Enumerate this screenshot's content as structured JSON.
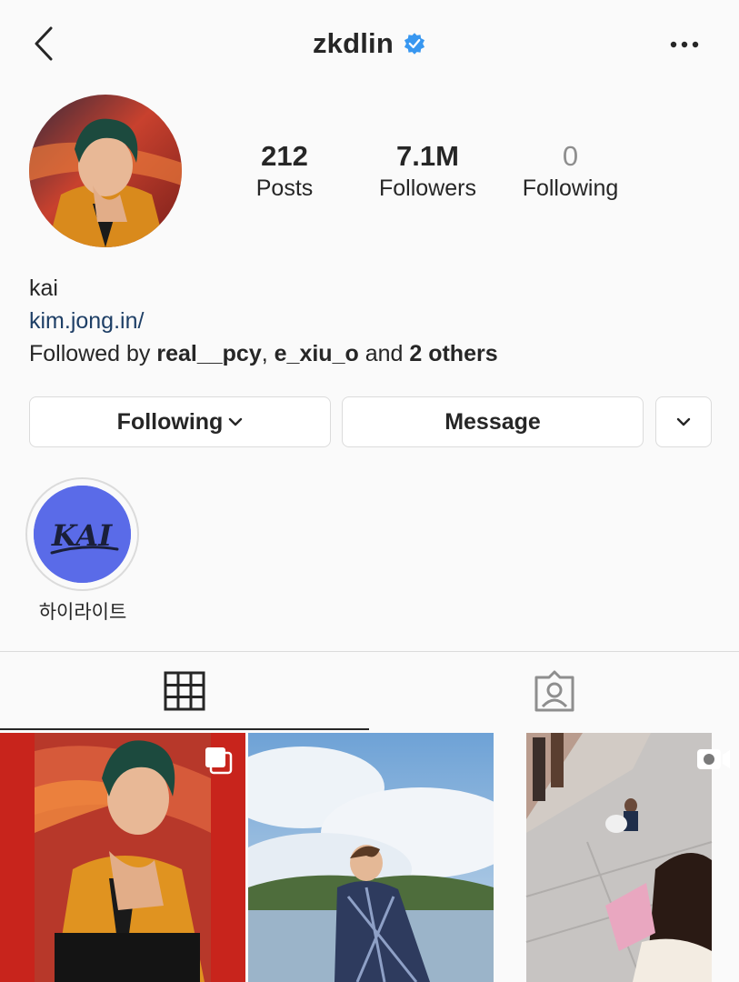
{
  "header": {
    "username": "zkdlin",
    "verified": true,
    "icons": [
      "chevron-left-icon",
      "verified-badge-icon",
      "more-horizontal-icon"
    ]
  },
  "profile": {
    "stats": [
      {
        "value": "212",
        "label": "Posts"
      },
      {
        "value": "7.1M",
        "label": "Followers"
      },
      {
        "value": "0",
        "label": "Following"
      }
    ],
    "name": "kai",
    "link": "kim.jong.in/",
    "followed_by": {
      "prefix": "Followed by ",
      "user1": "real__pcy",
      "sep": ", ",
      "user2": "e_xiu_o",
      "mid": " and ",
      "others": "2 others"
    }
  },
  "actions": {
    "following_label": "Following",
    "message_label": "Message"
  },
  "highlights": [
    {
      "label": "하이라이트",
      "cover_text": "KAI"
    }
  ],
  "tabs": {
    "active": "grid",
    "items": [
      "grid-icon",
      "tagged-icon"
    ]
  },
  "posts": [
    {
      "type": "carousel"
    },
    {
      "type": "photo"
    },
    {
      "type": "video"
    }
  ],
  "colors": {
    "background": "#fafafa",
    "text": "#262626",
    "muted": "#8e8e8e",
    "link": "#1e3f66",
    "border": "#dbdbdb",
    "verified": "#3897f0",
    "highlight_bg": "#5a6be8"
  }
}
